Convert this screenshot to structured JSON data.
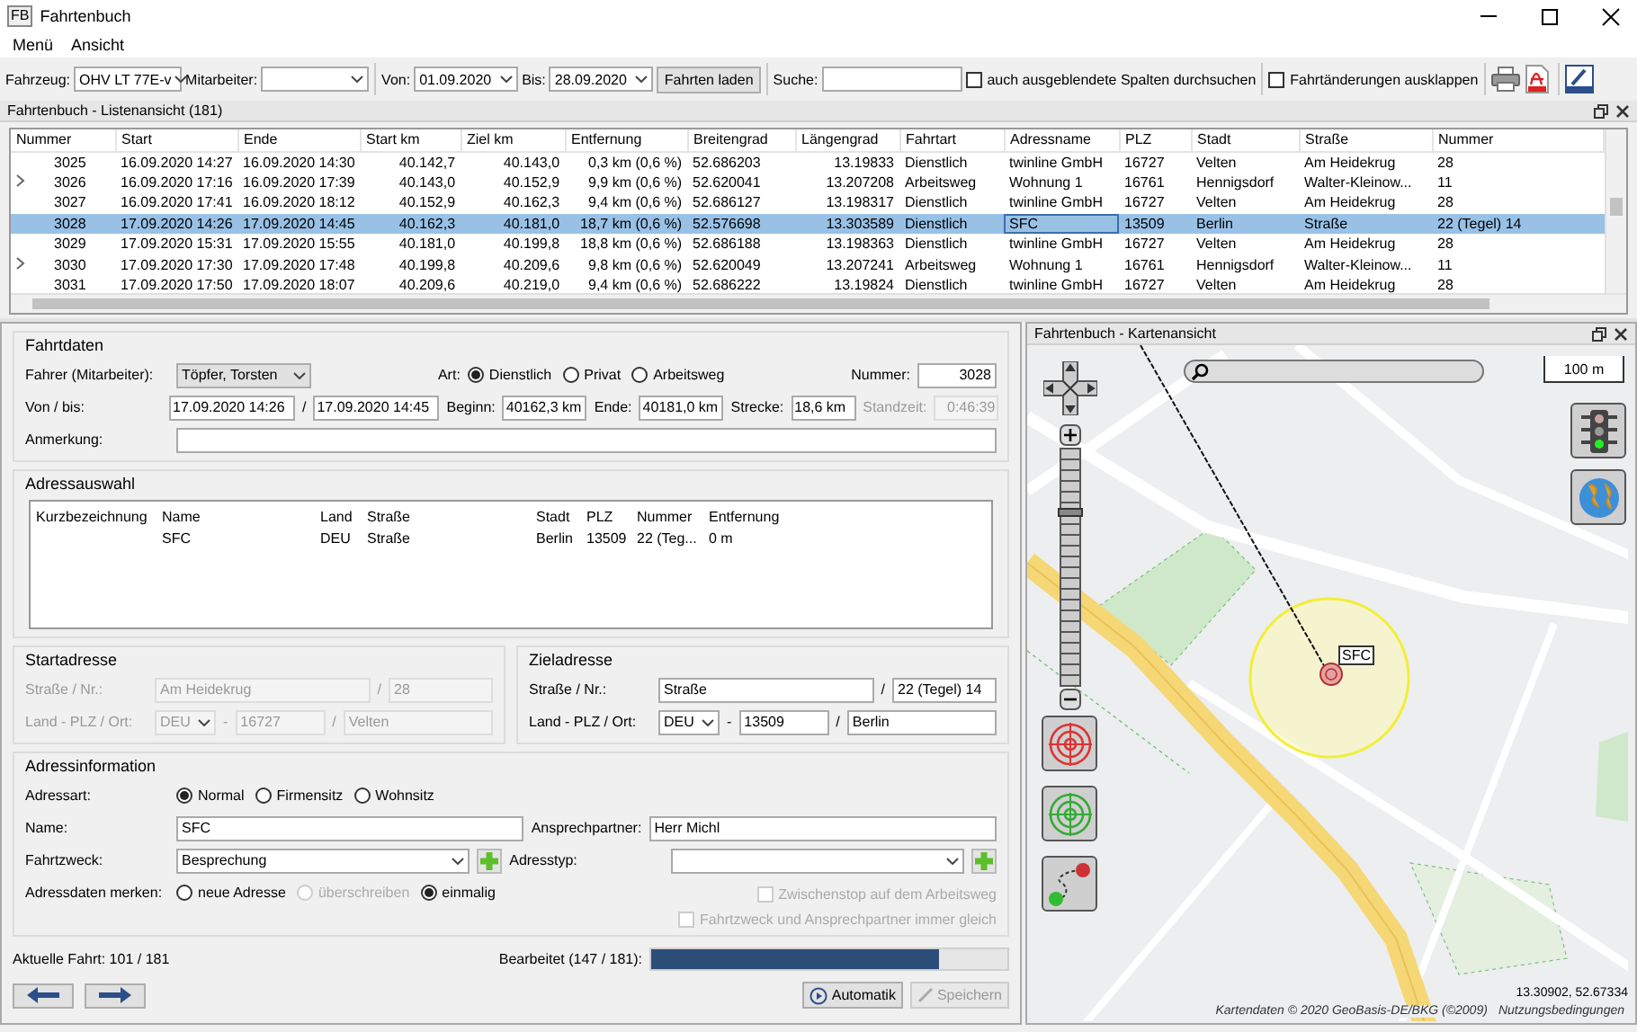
{
  "window": {
    "title": "Fahrtenbuch",
    "icon_text": "FB"
  },
  "menu": [
    "Menü",
    "Ansicht"
  ],
  "toolbar": {
    "vehicle_label": "Fahrzeug:",
    "vehicle": "OHV LT 77E-v",
    "employee_label": "Mitarbeiter:",
    "from_label": "Von:",
    "from": "01.09.2020",
    "to_label": "Bis:",
    "to": "28.09.2020",
    "load_button": "Fahrten laden",
    "search_label": "Suche:",
    "hidden_columns": {
      "label": "auch ausgeblendete Spalten durchsuchen",
      "checked": false
    },
    "expand_changes": {
      "label": "Fahrtänderungen ausklappen",
      "checked": false
    }
  },
  "list": {
    "title": "Fahrtenbuch - Listenansicht (181)",
    "columns": [
      "Nummer",
      "Start",
      "Ende",
      "Start km",
      "Ziel km",
      "Entfernung",
      "Breitengrad",
      "Längengrad",
      "Fahrtart",
      "Adressname",
      "PLZ",
      "Stadt",
      "Straße",
      "Nummer"
    ],
    "rows": [
      {
        "expandable": false,
        "selected": false,
        "cells": [
          "3025",
          "16.09.2020 14:27",
          "16.09.2020 14:30",
          "40.142,7",
          "40.143,0",
          "0,3 km (0,6 %)",
          "52.686203",
          "13.19833",
          "Dienstlich",
          "twinline GmbH",
          "16727",
          "Velten",
          "Am Heidekrug",
          "28"
        ]
      },
      {
        "expandable": true,
        "selected": false,
        "cells": [
          "3026",
          "16.09.2020 17:16",
          "16.09.2020 17:39",
          "40.143,0",
          "40.152,9",
          "9,9 km (0,6 %)",
          "52.620041",
          "13.207208",
          "Arbeitsweg",
          "Wohnung 1",
          "16761",
          "Hennigsdorf",
          "Walter-Kleinow...",
          "11"
        ]
      },
      {
        "expandable": false,
        "selected": false,
        "cells": [
          "3027",
          "16.09.2020 17:41",
          "16.09.2020 18:12",
          "40.152,9",
          "40.162,3",
          "9,4 km (0,6 %)",
          "52.686127",
          "13.198317",
          "Dienstlich",
          "twinline GmbH",
          "16727",
          "Velten",
          "Am Heidekrug",
          "28"
        ]
      },
      {
        "expandable": false,
        "selected": true,
        "cells": [
          "3028",
          "17.09.2020 14:26",
          "17.09.2020 14:45",
          "40.162,3",
          "40.181,0",
          "18,7 km (0,6 %)",
          "52.576698",
          "13.303589",
          "Dienstlich",
          "SFC",
          "13509",
          "Berlin",
          "Straße",
          "22 (Tegel) 14"
        ]
      },
      {
        "expandable": false,
        "selected": false,
        "cells": [
          "3029",
          "17.09.2020 15:31",
          "17.09.2020 15:55",
          "40.181,0",
          "40.199,8",
          "18,8 km (0,6 %)",
          "52.686188",
          "13.198363",
          "Dienstlich",
          "twinline GmbH",
          "16727",
          "Velten",
          "Am Heidekrug",
          "28"
        ]
      },
      {
        "expandable": true,
        "selected": false,
        "cells": [
          "3030",
          "17.09.2020 17:30",
          "17.09.2020 17:48",
          "40.199,8",
          "40.209,6",
          "9,8 km (0,6 %)",
          "52.620049",
          "13.207241",
          "Arbeitsweg",
          "Wohnung 1",
          "16761",
          "Hennigsdorf",
          "Walter-Kleinow...",
          "11"
        ]
      },
      {
        "expandable": false,
        "selected": false,
        "cells": [
          "3031",
          "17.09.2020 17:50",
          "17.09.2020 18:07",
          "40.209,6",
          "40.219,0",
          "9,4 km (0,6 %)",
          "52.686222",
          "13.19824",
          "Dienstlich",
          "twinline GmbH",
          "16727",
          "Velten",
          "Am Heidekrug",
          "28"
        ]
      }
    ]
  },
  "trip": {
    "title": "Fahrtdaten",
    "driver_label": "Fahrer (Mitarbeiter):",
    "driver": "Töpfer, Torsten",
    "type_label": "Art:",
    "types": [
      {
        "label": "Dienstlich",
        "selected": true
      },
      {
        "label": "Privat",
        "selected": false
      },
      {
        "label": "Arbeitsweg",
        "selected": false
      }
    ],
    "number_label": "Nummer:",
    "number": "3028",
    "period_label": "Von / bis:",
    "start": "17.09.2020 14:26",
    "period_separator": "/",
    "end": "17.09.2020 14:45",
    "begin_label": "Beginn:",
    "begin_km": "40162,3 km",
    "end_label": "Ende:",
    "end_km": "40181,0 km",
    "distance_label": "Strecke:",
    "distance": "18,6 km",
    "idle_label": "Standzeit:",
    "idle": "0:46:39",
    "note_label": "Anmerkung:"
  },
  "address_selection": {
    "title": "Adressauswahl",
    "columns": [
      "Kurzbezeichnung",
      "Name",
      "Land",
      "Straße",
      "Stadt",
      "PLZ",
      "Nummer",
      "Entfernung"
    ],
    "rows": [
      {
        "name": "SFC",
        "country": "DEU",
        "street": "Straße",
        "city": "Berlin",
        "zip": "13509",
        "number": "22 (Teg...",
        "distance": "0 m"
      }
    ]
  },
  "start_address": {
    "title": "Startadresse",
    "disabled": true,
    "street_label": "Straße / Nr.:",
    "street": "Am Heidekrug",
    "number_separator": "/",
    "number": "28",
    "place_label": "Land - PLZ / Ort:",
    "country": "DEU",
    "zip_separator": "-",
    "zip": "16727",
    "city_separator": "/",
    "city": "Velten"
  },
  "destination_address": {
    "title": "Zieladresse",
    "disabled": false,
    "street_label": "Straße / Nr.:",
    "street": "Straße",
    "number_separator": "/",
    "number": "22 (Tegel) 14",
    "place_label": "Land - PLZ / Ort:",
    "country": "DEU",
    "zip_separator": "-",
    "zip": "13509",
    "city_separator": "/",
    "city": "Berlin"
  },
  "address_info": {
    "title": "Adressinformation",
    "kind_label": "Adressart:",
    "kinds": [
      {
        "label": "Normal",
        "selected": true
      },
      {
        "label": "Firmensitz",
        "selected": false
      },
      {
        "label": "Wohnsitz",
        "selected": false
      }
    ],
    "name_label": "Name:",
    "name": "SFC",
    "contact_label": "Ansprechpartner:",
    "contact": "Herr Michl",
    "purpose_label": "Fahrtzweck:",
    "purpose": "Besprechung",
    "type_label": "Adresstyp:",
    "remember_label": "Adressdaten merken:",
    "remember": [
      {
        "label": "neue Adresse",
        "selected": false,
        "disabled": false
      },
      {
        "label": "überschreiben",
        "selected": false,
        "disabled": true
      },
      {
        "label": "einmalig",
        "selected": true,
        "disabled": false
      }
    ],
    "checkboxes": [
      {
        "label": "Zwischenstop auf dem Arbeitsweg",
        "checked": false,
        "disabled": true
      },
      {
        "label": "Fahrtzweck und Ansprechpartner immer gleich",
        "checked": false,
        "disabled": true
      }
    ]
  },
  "footer": {
    "current": "Aktuelle Fahrt: 101 / 181",
    "progress_label": "Bearbeitet (147 / 181):",
    "progress": {
      "level": 0.81
    },
    "auto_button": "Automatik",
    "save_button": {
      "label": "Speichern",
      "disabled": true
    }
  },
  "map": {
    "title": "Fahrtenbuch - Kartenansicht",
    "scale": "100 m",
    "zoom": {
      "level": 0.73
    },
    "marker_label": "SFC",
    "coordinates": "13.30902, 52.67334",
    "attribution": "Kartendaten © 2020 GeoBasis-DE/BKG (©2009)",
    "terms": "Nutzungsbedingungen"
  }
}
